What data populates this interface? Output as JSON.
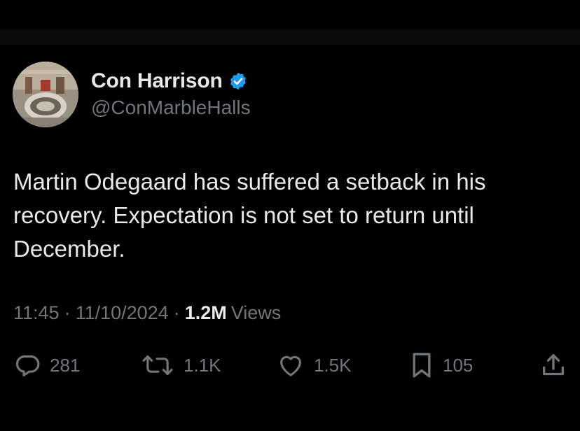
{
  "author": {
    "display_name": "Con Harrison",
    "handle": "@ConMarbleHalls",
    "verified": true,
    "verified_color": "#1d9bf0",
    "avatar": "avatar-photo"
  },
  "tweet": {
    "text": "Martin Odegaard has suffered a setback in his recovery. Expectation is not set to return until December."
  },
  "meta": {
    "time": "11:45",
    "separator": "·",
    "date": "11/10/2024",
    "views_count": "1.2M",
    "views_label": "Views"
  },
  "actions": [
    {
      "icon": "reply-icon",
      "count": "281"
    },
    {
      "icon": "retweet-icon",
      "count": "1.1K"
    },
    {
      "icon": "like-icon",
      "count": "1.5K"
    },
    {
      "icon": "bookmark-icon",
      "count": "105"
    },
    {
      "icon": "share-icon",
      "count": ""
    }
  ],
  "colors": {
    "background": "#000000",
    "text": "#e7e9ea",
    "secondary_text": "#71767b"
  }
}
